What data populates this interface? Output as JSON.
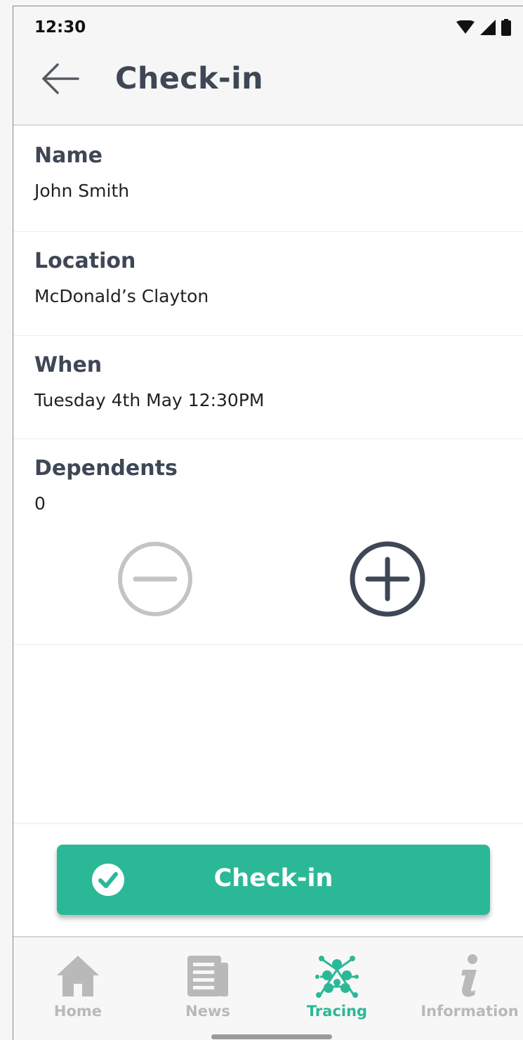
{
  "status_bar": {
    "time": "12:30"
  },
  "header": {
    "title": "Check-in",
    "back_icon": "arrow-left-icon"
  },
  "fields": {
    "name": {
      "label": "Name",
      "value": "John Smith"
    },
    "location": {
      "label": "Location",
      "value": "McDonald’s Clayton"
    },
    "when": {
      "label": "When",
      "value": "Tuesday 4th May 12:30PM"
    },
    "dependents": {
      "label": "Dependents",
      "value": "0"
    }
  },
  "stepper": {
    "minus_icon": "minus-circle-icon",
    "plus_icon": "plus-circle-icon",
    "minus_enabled": false,
    "plus_enabled": true
  },
  "primary_action": {
    "label": "Check-in",
    "icon": "check-circle-icon"
  },
  "bottom_nav": {
    "items": [
      {
        "label": "Home",
        "icon": "home-icon",
        "active": false
      },
      {
        "label": "News",
        "icon": "newspaper-icon",
        "active": false
      },
      {
        "label": "Tracing",
        "icon": "tracing-network-icon",
        "active": true
      },
      {
        "label": "Information",
        "icon": "info-icon",
        "active": false
      }
    ]
  },
  "colors": {
    "accent": "#2bb897",
    "text_dark": "#3f4756",
    "disabled": "#c4c4c4",
    "nav_inactive": "#b9b9b9",
    "app_bar": "#f6f6f6"
  }
}
